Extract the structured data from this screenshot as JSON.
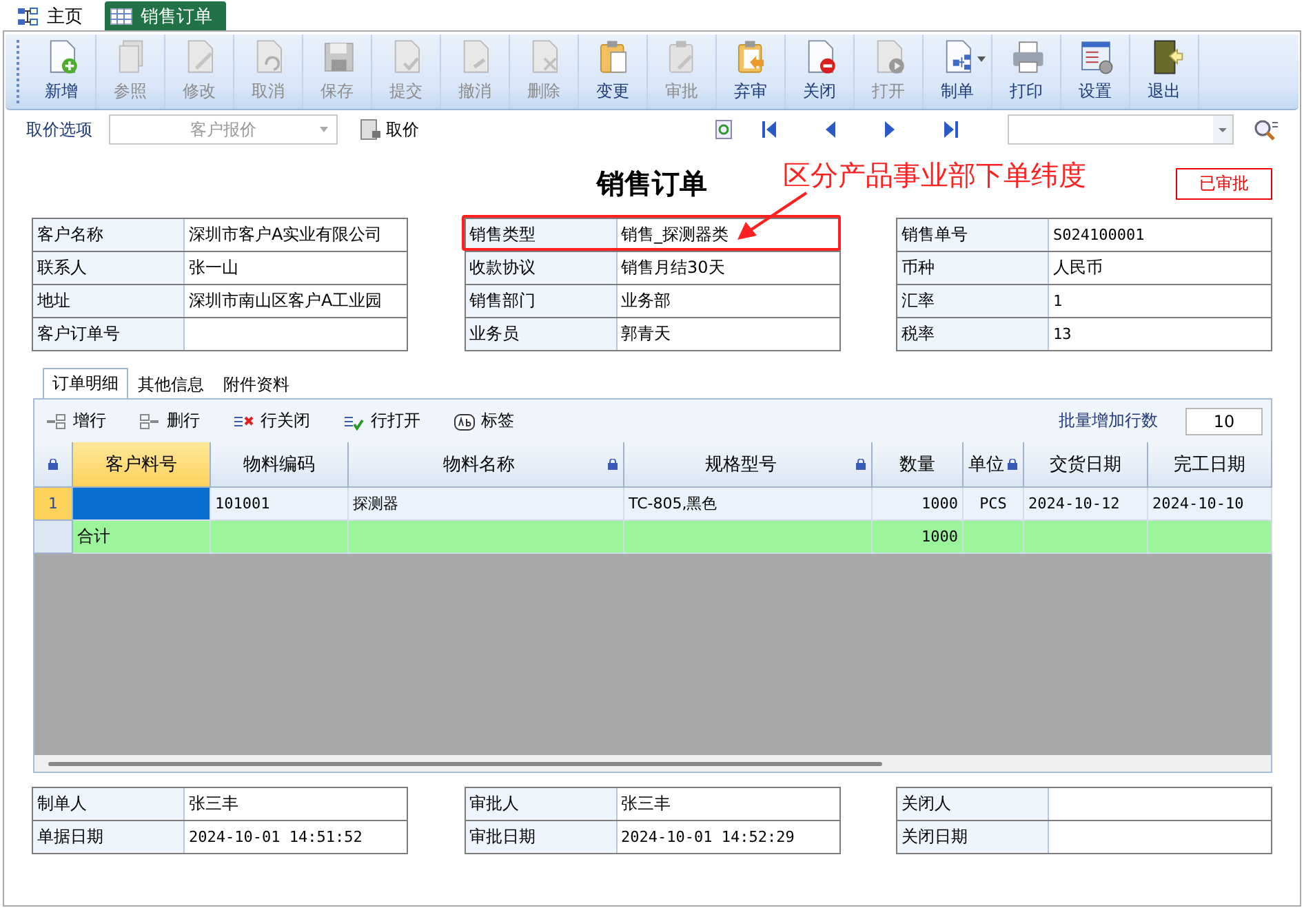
{
  "tabs": [
    {
      "label": "主页",
      "selected": false
    },
    {
      "label": "销售订单",
      "selected": true
    }
  ],
  "toolbar": [
    {
      "label": "新增",
      "disabled": false
    },
    {
      "label": "参照",
      "disabled": true
    },
    {
      "label": "修改",
      "disabled": true
    },
    {
      "label": "取消",
      "disabled": true
    },
    {
      "label": "保存",
      "disabled": true
    },
    {
      "label": "提交",
      "disabled": true
    },
    {
      "label": "撤消",
      "disabled": true
    },
    {
      "label": "删除",
      "disabled": true
    },
    {
      "label": "变更",
      "disabled": false
    },
    {
      "label": "审批",
      "disabled": true
    },
    {
      "label": "弃审",
      "disabled": false
    },
    {
      "label": "关闭",
      "disabled": false
    },
    {
      "label": "打开",
      "disabled": true
    },
    {
      "label": "制单",
      "disabled": false,
      "dropdown": true
    },
    {
      "label": "打印",
      "disabled": false
    },
    {
      "label": "设置",
      "disabled": false
    },
    {
      "label": "退出",
      "disabled": false
    }
  ],
  "price_bar": {
    "label": "取价选项",
    "select": {
      "value": "客户报价",
      "disabled": true
    },
    "button": "取价"
  },
  "document": {
    "title": "销售订单",
    "status": "已审批",
    "header_groups": [
      [
        {
          "label": "客户名称",
          "value": "深圳市客户A实业有限公司"
        },
        {
          "label": "联系人",
          "value": "张一山"
        },
        {
          "label": "地址",
          "value": "深圳市南山区客户A工业园"
        },
        {
          "label": "客户订单号"
        }
      ],
      [
        {
          "label": "销售类型",
          "value": "销售_探测器类",
          "highlighted": true
        },
        {
          "label": "收款协议",
          "value": "销售月结30天"
        },
        {
          "label": "销售部门",
          "value": "业务部"
        },
        {
          "label": "业务员",
          "value": "郭青天"
        }
      ],
      [
        {
          "label": "销售单号",
          "value": "S024100001"
        },
        {
          "label": "币种",
          "value": "人民币"
        },
        {
          "label": "汇率",
          "value": "1"
        },
        {
          "label": "税率",
          "value": "13"
        }
      ]
    ]
  },
  "annotation": {
    "text": "区分产品事业部下单纬度"
  },
  "detail_tabs": [
    {
      "label": "订单明细",
      "selected": true
    },
    {
      "label": "其他信息",
      "selected": false
    },
    {
      "label": "附件资料",
      "selected": false
    }
  ],
  "grid_toolbar": {
    "buttons": [
      {
        "label": "增行"
      },
      {
        "label": "删行"
      },
      {
        "label": "行关闭"
      },
      {
        "label": "行打开"
      },
      {
        "label": "标签"
      }
    ],
    "batch_label": "批量增加行数",
    "batch_value": "10"
  },
  "grid": {
    "columns": [
      {
        "label": "客户料号",
        "locked": false,
        "selected": true
      },
      {
        "label": "物料编码",
        "locked": false,
        "selected": false
      },
      {
        "label": "物料名称",
        "locked": true,
        "selected": false
      },
      {
        "label": "规格型号",
        "locked": true,
        "selected": false
      },
      {
        "label": "数量",
        "locked": false,
        "selected": false
      },
      {
        "label": "单位",
        "locked": true,
        "selected": false
      },
      {
        "label": "交货日期",
        "locked": false,
        "selected": false
      },
      {
        "label": "完工日期",
        "locked": false,
        "selected": false
      }
    ],
    "rows": [
      {
        "row_number": "1",
        "selected": true,
        "cells": [
          null,
          "101001",
          "探测器",
          "TC-805,黑色",
          "1000",
          "PCS",
          "2024-10-12",
          "2024-10-10"
        ]
      }
    ],
    "total_row": {
      "cells": [
        "合计",
        null,
        null,
        null,
        "1000",
        null,
        null,
        null
      ]
    }
  },
  "footer_groups": [
    [
      {
        "label": "制单人",
        "value": "张三丰"
      },
      {
        "label": "单据日期",
        "value": "2024-10-01 14:51:52"
      }
    ],
    [
      {
        "label": "审批人",
        "value": "张三丰"
      },
      {
        "label": "审批日期",
        "value": "2024-10-01 14:52:29"
      }
    ],
    [
      {
        "label": "关闭人"
      },
      {
        "label": "关闭日期"
      }
    ]
  ]
}
